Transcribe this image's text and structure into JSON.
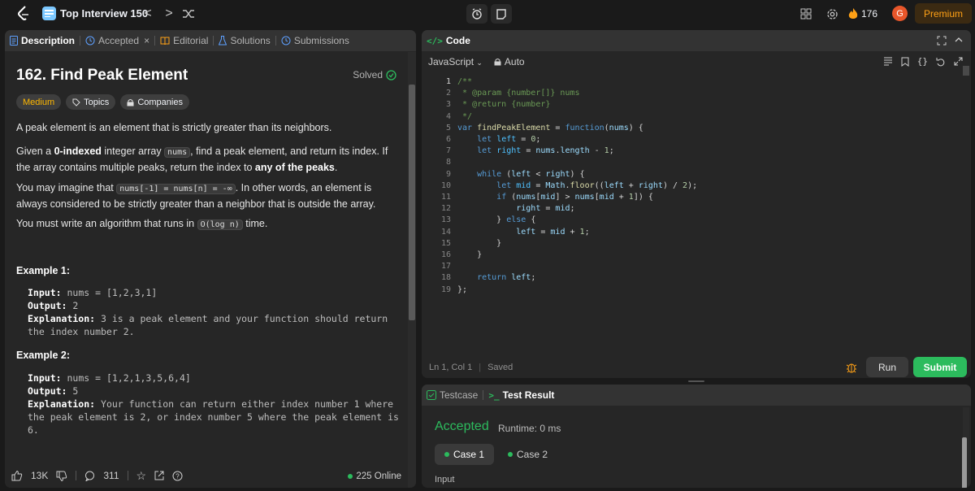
{
  "nav": {
    "list_title": "Top Interview 150",
    "prev": "<",
    "next": ">",
    "streak_count": "176",
    "avatar_initial": "G",
    "premium": "Premium"
  },
  "left_tabs": [
    {
      "label": "Description"
    },
    {
      "label": "Accepted"
    },
    {
      "label": "Editorial"
    },
    {
      "label": "Solutions"
    },
    {
      "label": "Submissions"
    }
  ],
  "problem": {
    "title": "162. Find Peak Element",
    "solved_label": "Solved",
    "tags": {
      "difficulty": "Medium",
      "topics": "Topics",
      "companies": "Companies"
    },
    "p1": "A peak element is an element that is strictly greater than its neighbors.",
    "p2_a": "Given a ",
    "p2_b": "0-indexed",
    "p2_c": " integer array ",
    "p2_code": "nums",
    "p2_d": ", find a peak element, and return its index. If the array contains multiple peaks, return the index to ",
    "p2_e": "any of the peaks",
    "p2_f": ".",
    "p3_a": "You may imagine that ",
    "p3_code": "nums[-1] = nums[n] = -∞",
    "p3_b": ". In other words, an element is always considered to be strictly greater than a neighbor that is outside the array.",
    "p4_a": "You must write an algorithm that runs in ",
    "p4_code": "O(log n)",
    "p4_b": " time.",
    "ex1_title": "Example 1:",
    "ex1_input_lbl": "Input:",
    "ex1_input": "nums = [1,2,3,1]",
    "ex1_output_lbl": "Output:",
    "ex1_output": "2",
    "ex1_expl_lbl": "Explanation:",
    "ex1_expl": "3 is a peak element and your function should return the index number 2.",
    "ex2_title": "Example 2:",
    "ex2_input_lbl": "Input:",
    "ex2_input": "nums = [1,2,1,3,5,6,4]",
    "ex2_output_lbl": "Output:",
    "ex2_output": "5",
    "ex2_expl_lbl": "Explanation:",
    "ex2_expl": "Your function can return either index number 1 where the peak element is 2, or index number 5 where the peak element is 6."
  },
  "footer": {
    "likes": "13K",
    "comments": "311",
    "online": "225 Online"
  },
  "code_panel": {
    "tab": "Code",
    "language": "JavaScript",
    "mode": "Auto",
    "line_numbers": [
      "1",
      "2",
      "3",
      "4",
      "5",
      "6",
      "7",
      "8",
      "9",
      "10",
      "11",
      "12",
      "13",
      "14",
      "15",
      "16",
      "17",
      "18",
      "19"
    ],
    "status_pos": "Ln 1, Col 1",
    "status_saved": "Saved",
    "run": "Run",
    "submit": "Submit"
  },
  "result_panel": {
    "tab_testcase": "Testcase",
    "tab_result": "Test Result",
    "verdict": "Accepted",
    "runtime": "Runtime: 0 ms",
    "case1": "Case 1",
    "case2": "Case 2",
    "input_label": "Input"
  },
  "colors": {
    "accent": "#ffa116",
    "success": "#2cbb5d",
    "medium": "#ffb800"
  },
  "icons": [
    "leetcode-logo-icon",
    "list-icon",
    "shuffle-icon",
    "alarm-clock-icon",
    "note-icon",
    "layout-icon",
    "settings-icon",
    "fire-icon",
    "file-icon",
    "flask-icon",
    "book-icon",
    "beaker-icon",
    "history-icon",
    "code-icon",
    "lock-icon",
    "check-circle-icon",
    "tag-icon",
    "thumbs-up-icon",
    "thumbs-down-icon",
    "comment-icon",
    "star-icon",
    "share-icon",
    "help-icon",
    "align-icon",
    "bookmark-icon",
    "braces-icon",
    "undo-icon",
    "expand-icon",
    "chevron-up-icon",
    "bug-icon",
    "checkbox-icon",
    "terminal-icon"
  ]
}
